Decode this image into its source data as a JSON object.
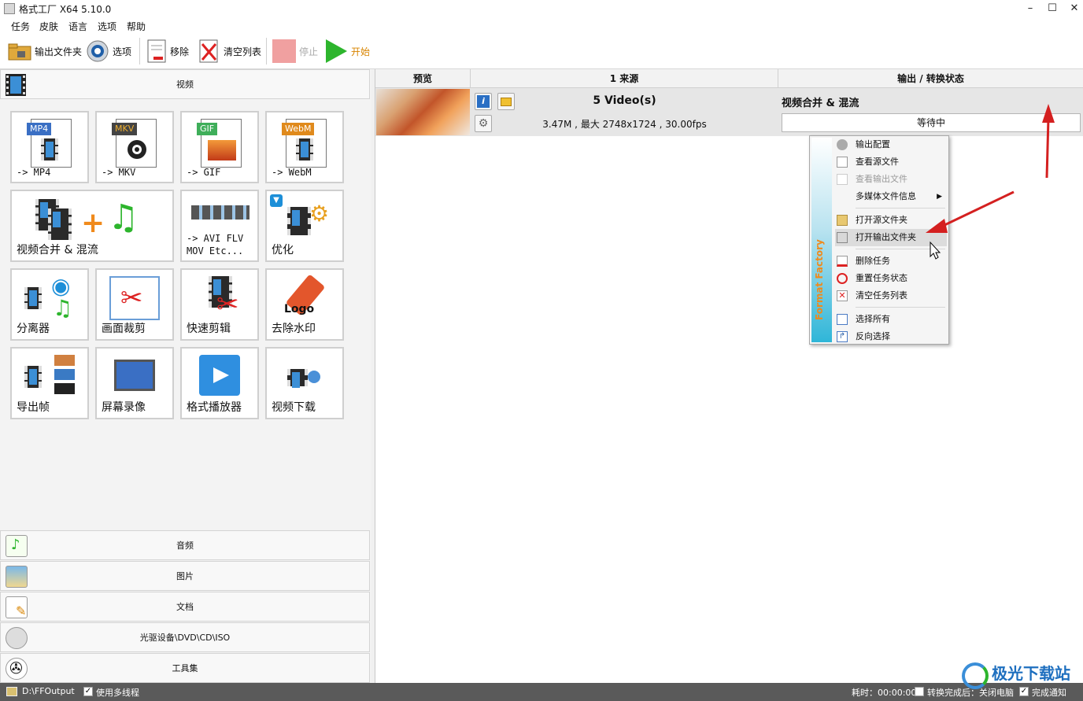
{
  "window": {
    "title": "格式工厂 X64 5.10.0"
  },
  "menu": [
    "任务",
    "皮肤",
    "语言",
    "选项",
    "帮助"
  ],
  "toolbar": {
    "output_folder": "输出文件夹",
    "options": "选项",
    "remove": "移除",
    "clear_list": "清空列表",
    "stop": "停止",
    "start": "开始"
  },
  "left": {
    "video_category": "视频",
    "tiles": [
      {
        "tag": "MP4",
        "label": "-> MP4"
      },
      {
        "tag": "MKV",
        "label": "-> MKV"
      },
      {
        "tag": "GIF",
        "label": "-> GIF"
      },
      {
        "tag": "WebM",
        "label": "-> WebM"
      },
      {
        "label": "视频合并 & 混流"
      },
      {
        "label": "-> AVI FLV\nMOV Etc..."
      },
      {
        "label": "优化"
      },
      {
        "label": "分离器"
      },
      {
        "label": "画面裁剪"
      },
      {
        "label": "快速剪辑"
      },
      {
        "label": "去除水印",
        "logo_text": "Logo"
      },
      {
        "label": "导出帧"
      },
      {
        "label": "屏幕录像"
      },
      {
        "label": "格式播放器"
      },
      {
        "label": "视频下载"
      }
    ],
    "categories": [
      "音频",
      "图片",
      "文档",
      "光驱设备\\DVD\\CD\\ISO",
      "工具集"
    ]
  },
  "task_list": {
    "columns": [
      "预览",
      "1 来源",
      "输出 / 转换状态"
    ],
    "row": {
      "source_title": "5 Video(s)",
      "source_info": "3.47M , 最大 2748x1724 , 30.00fps",
      "output_title": "视频合并 & 混流",
      "status": "等待中"
    }
  },
  "context_menu": {
    "brand": "Format Factory",
    "items": [
      {
        "label": "输出配置",
        "enabled": true,
        "icon": "gear-icon"
      },
      {
        "label": "查看源文件",
        "enabled": true,
        "icon": "document-icon"
      },
      {
        "label": "查看输出文件",
        "enabled": false,
        "icon": "document-icon"
      },
      {
        "label": "多媒体文件信息",
        "enabled": true,
        "submenu": true
      },
      {
        "label": "打开源文件夹",
        "enabled": true,
        "icon": "folder-icon"
      },
      {
        "label": "打开输出文件夹",
        "enabled": true,
        "highlighted": true,
        "icon": "folder-icon"
      },
      {
        "label": "删除任务",
        "enabled": true,
        "icon": "remove-icon"
      },
      {
        "label": "重置任务状态",
        "enabled": true,
        "icon": "reset-icon"
      },
      {
        "label": "清空任务列表",
        "enabled": true,
        "icon": "clear-icon"
      },
      {
        "label": "选择所有",
        "enabled": true,
        "icon": "select-all-icon"
      },
      {
        "label": "反向选择",
        "enabled": true,
        "icon": "invert-selection-icon"
      }
    ]
  },
  "status_bar": {
    "output_path": "D:\\FFOutput",
    "multithread": "使用多线程",
    "elapsed": "耗时：00:00:00",
    "after_convert": "转换完成后：关闭电脑",
    "notify": "完成通知"
  },
  "watermark": {
    "text": "极光下载站"
  },
  "colors": {
    "accent_green": "#2db52d",
    "stop_red": "#f0a0a0",
    "arrow_red": "#d42020",
    "brand_orange": "#f08a1c"
  }
}
